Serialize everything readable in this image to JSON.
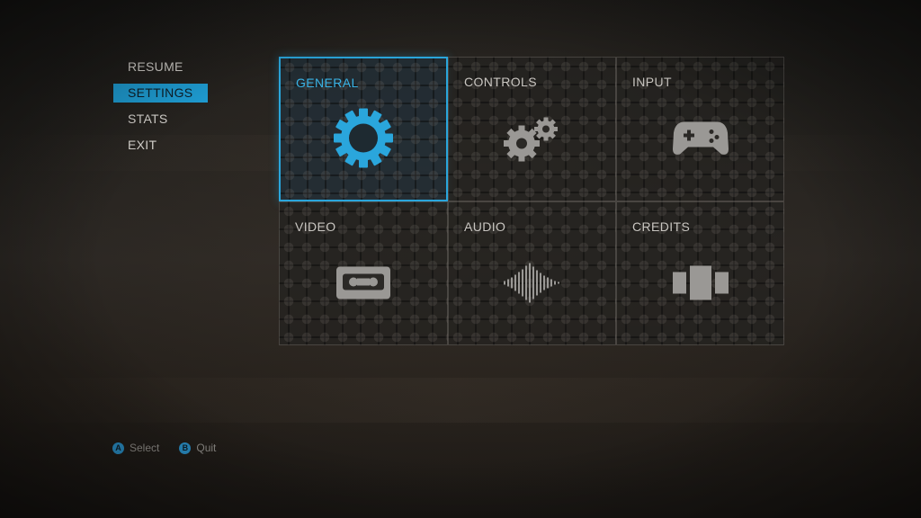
{
  "side_menu": {
    "items": [
      {
        "label": "RESUME"
      },
      {
        "label": "SETTINGS",
        "active": true
      },
      {
        "label": "STATS"
      },
      {
        "label": "EXIT"
      }
    ]
  },
  "tiles": [
    {
      "label": "GENERAL",
      "icon": "gear-icon",
      "selected": true
    },
    {
      "label": "CONTROLS",
      "icon": "gears-icon"
    },
    {
      "label": "INPUT",
      "icon": "gamepad-icon"
    },
    {
      "label": "VIDEO",
      "icon": "cassette-icon"
    },
    {
      "label": "AUDIO",
      "icon": "waveform-icon"
    },
    {
      "label": "CREDITS",
      "icon": "panels-icon"
    }
  ],
  "footer": {
    "select": {
      "glyph": "A",
      "label": "Select"
    },
    "quit": {
      "glyph": "B",
      "label": "Quit"
    }
  },
  "colors": {
    "accent": "#2aa6dc",
    "icon_inactive": "#9a9895",
    "text": "#d7d4cf"
  }
}
